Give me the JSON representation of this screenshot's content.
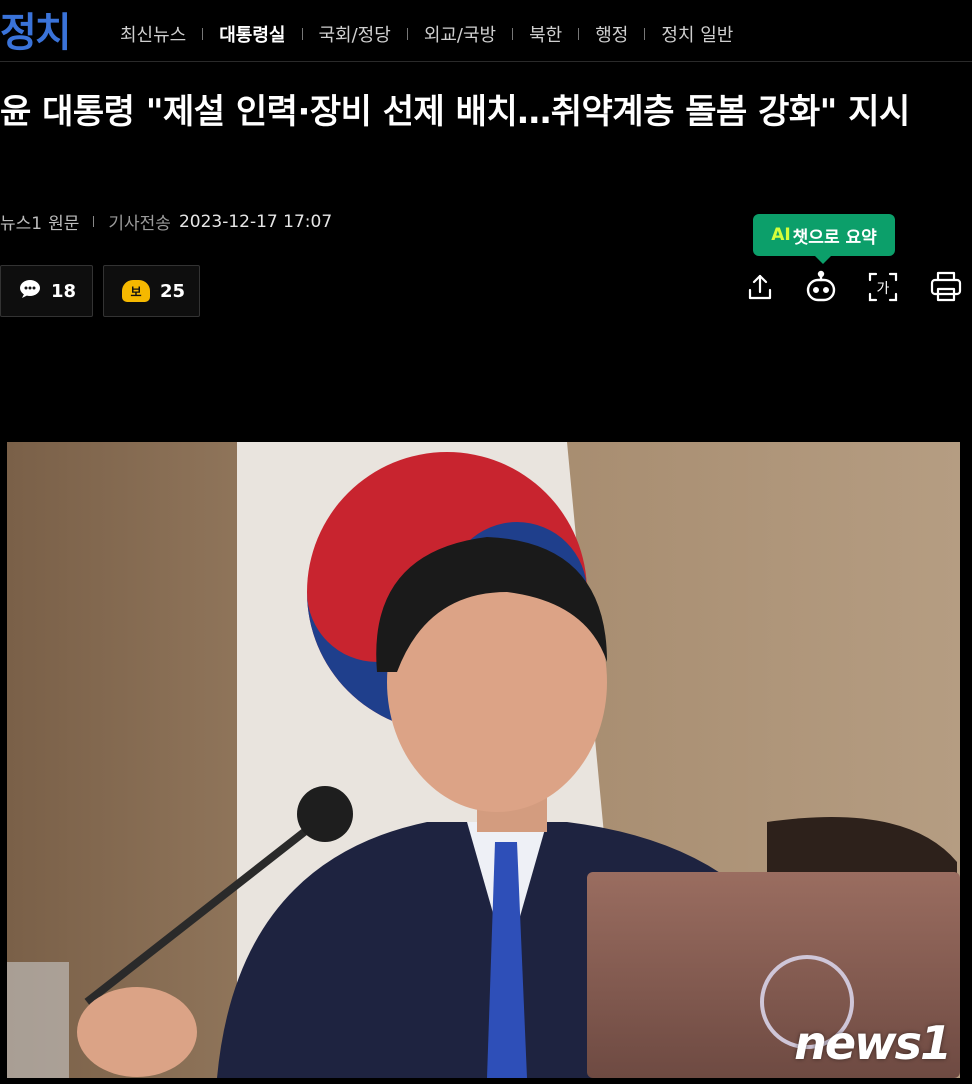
{
  "section": {
    "logo_text": "정치",
    "nav": [
      "최신뉴스",
      "대통령실",
      "국회/정당",
      "외교/국방",
      "북한",
      "행정",
      "정치 일반"
    ],
    "active": "대통령실"
  },
  "article": {
    "headline": "윤 대통령 \"제설 인력·장비 선제 배치…취약계층 돌봄 강화\" 지시",
    "source": "뉴스1",
    "source_link": "원문",
    "sent_label": "기사전송",
    "sent_date": "2023-12-17 17:07"
  },
  "reactions": {
    "comments": "18",
    "recommend_badge": "보",
    "recommend": "25"
  },
  "tools": {
    "ai_tooltip_prefix": "AI",
    "ai_tooltip_rest": "챗으로 요약",
    "icons": [
      "share-icon",
      "ai-bot-icon",
      "font-size-icon",
      "print-icon"
    ],
    "font_icon_glyph": "가"
  },
  "photo": {
    "watermark": "news1"
  },
  "colors": {
    "section_blue": "#3a73d9",
    "ai_green": "#0c9f6a",
    "recommend_yellow": "#f5b800"
  }
}
